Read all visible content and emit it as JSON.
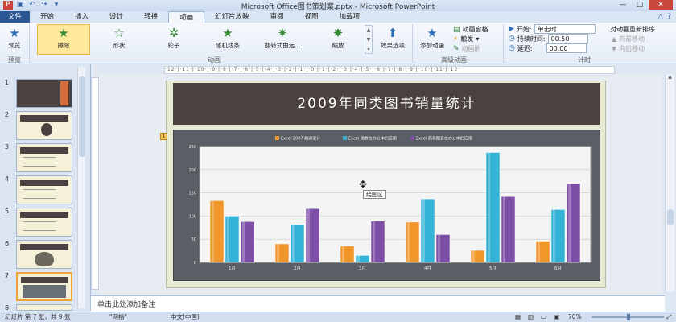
{
  "window": {
    "title": "Microsoft Office图书策划案.pptx - Microsoft PowerPoint",
    "minimize": "—",
    "restore": "□",
    "close": "✕"
  },
  "tabs": [
    {
      "label": "文件"
    },
    {
      "label": "开始"
    },
    {
      "label": "插入"
    },
    {
      "label": "设计"
    },
    {
      "label": "转换"
    },
    {
      "label": "动画"
    },
    {
      "label": "幻灯片放映"
    },
    {
      "label": "审阅"
    },
    {
      "label": "视图"
    },
    {
      "label": "加载项"
    }
  ],
  "ribbon": {
    "preview": {
      "button": "预览",
      "group": "预览"
    },
    "animations": {
      "group": "动画",
      "items": [
        {
          "label": "擦除",
          "selected": true
        },
        {
          "label": "形状"
        },
        {
          "label": "轮子"
        },
        {
          "label": "随机线条"
        },
        {
          "label": "翻转式由远..."
        },
        {
          "label": "缩放"
        }
      ],
      "effect_options": "效果选项"
    },
    "advanced": {
      "group": "高级动画",
      "add_animation": "添加动画",
      "animation_pane": "动画窗格",
      "trigger": "触发",
      "animation_painter": "动画刷"
    },
    "timing": {
      "group": "计时",
      "start_label": "开始:",
      "start_value": "单击时",
      "duration_label": "持续时间:",
      "duration_value": "00.50",
      "delay_label": "延迟:",
      "delay_value": "00.00",
      "reorder_title": "对动画重新排序",
      "move_earlier": "向前移动",
      "move_later": "向后移动"
    }
  },
  "slides_pane": {
    "numbers": [
      "1",
      "2",
      "3",
      "4",
      "5",
      "6",
      "7",
      "8"
    ],
    "selected_index": 7
  },
  "slide": {
    "title": "2009年同类图书销量统计",
    "animation_badge": "1",
    "tooltip": "绘图区"
  },
  "chart_data": {
    "type": "bar",
    "categories": [
      "1月",
      "2月",
      "3月",
      "4月",
      "5月",
      "6月"
    ],
    "series": [
      {
        "name": "Excel 2007 精通设计",
        "color": "#f0962a",
        "values": [
          133,
          40,
          35,
          87,
          26,
          46
        ]
      },
      {
        "name": "Excel 函数在办公中的应用",
        "color": "#33b3d6",
        "values": [
          100,
          82,
          15,
          137,
          237,
          114
        ]
      },
      {
        "name": "Excel 商务图表在办公中的应用",
        "color": "#7d4fa6",
        "values": [
          88,
          116,
          89,
          60,
          142,
          170
        ]
      }
    ],
    "ylim": [
      0,
      250
    ],
    "yticks": [
      "0",
      "50",
      "100",
      "150",
      "200",
      "250"
    ],
    "legend_position": "top",
    "grid": true
  },
  "notes": {
    "placeholder": "单击此处添加备注"
  },
  "statusbar": {
    "slide_info": "幻灯片 第 7 张，共 9 张",
    "theme": "\"网格\"",
    "language": "中文(中国)",
    "zoom": "70%"
  }
}
